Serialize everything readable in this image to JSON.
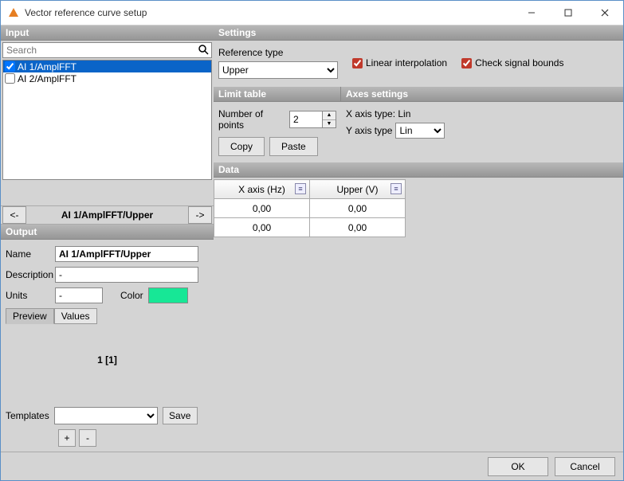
{
  "window": {
    "title": "Vector reference curve setup"
  },
  "input": {
    "header": "Input",
    "search_placeholder": "Search",
    "items": [
      {
        "label": "AI 1/AmplFFT",
        "checked": true,
        "selected": true
      },
      {
        "label": "AI 2/AmplFFT",
        "checked": false,
        "selected": false
      }
    ]
  },
  "nav": {
    "prev": "<-",
    "next": "->",
    "title": "AI 1/AmplFFT/Upper"
  },
  "output": {
    "header": "Output",
    "name_label": "Name",
    "name_value": "AI 1/AmplFFT/Upper",
    "desc_label": "Description",
    "desc_value": "-",
    "units_label": "Units",
    "units_value": "-",
    "color_label": "Color",
    "color_value": "#17e796",
    "tabs": {
      "preview": "Preview",
      "values": "Values"
    },
    "preview_text": "1 [1]",
    "templates_label": "Templates",
    "save_label": "Save",
    "add_label": "+",
    "remove_label": "-"
  },
  "settings": {
    "header": "Settings",
    "reftype_label": "Reference type",
    "reftype_value": "Upper",
    "linear_label": "Linear interpolation",
    "bounds_label": "Check signal bounds"
  },
  "limit": {
    "header": "Limit table",
    "points_label": "Number of points",
    "points_value": "2",
    "copy_label": "Copy",
    "paste_label": "Paste"
  },
  "axes": {
    "header": "Axes settings",
    "x_label": "X axis type: Lin",
    "y_label": "Y axis type",
    "y_value": "Lin"
  },
  "data": {
    "header": "Data",
    "col_x": "X axis (Hz)",
    "col_u": "Upper (V)",
    "rows": [
      {
        "x": "0,00",
        "u": "0,00"
      },
      {
        "x": "0,00",
        "u": "0,00"
      }
    ]
  },
  "footer": {
    "ok": "OK",
    "cancel": "Cancel"
  }
}
